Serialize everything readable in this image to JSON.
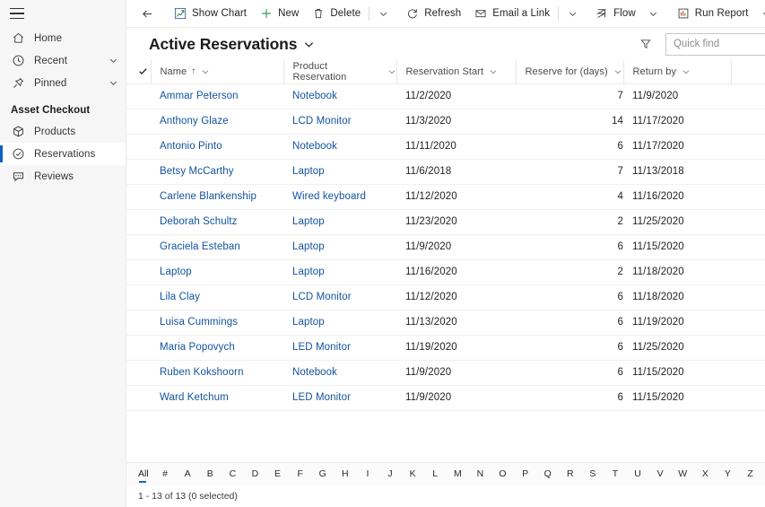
{
  "sidebar": {
    "menu_icon": "hamburger-icon",
    "top_items": [
      {
        "label": "Home",
        "icon": "home-icon",
        "chevron": false
      },
      {
        "label": "Recent",
        "icon": "clock-icon",
        "chevron": true
      },
      {
        "label": "Pinned",
        "icon": "pin-icon",
        "chevron": true
      }
    ],
    "group_title": "Asset Checkout",
    "group_items": [
      {
        "label": "Products",
        "icon": "box-icon",
        "selected": false
      },
      {
        "label": "Reservations",
        "icon": "check-circle-icon",
        "selected": true
      },
      {
        "label": "Reviews",
        "icon": "comment-icon",
        "selected": false
      }
    ],
    "accent_color": "#0a64c2",
    "background_color": "#f6f6f6"
  },
  "commandbar": {
    "back": "back-arrow-icon",
    "items": [
      {
        "label": "Show Chart",
        "icon": "chart-icon",
        "chevron": false,
        "sep_after": false
      },
      {
        "label": "New",
        "icon": "plus-icon",
        "chevron": false,
        "sep_after": false
      },
      {
        "label": "Delete",
        "icon": "trash-icon",
        "chevron": true,
        "sep_after": true
      },
      {
        "label": "Refresh",
        "icon": "refresh-icon",
        "chevron": false,
        "sep_after": false
      },
      {
        "label": "Email a Link",
        "icon": "email-icon",
        "chevron": true,
        "sep_after": true
      },
      {
        "label": "Flow",
        "icon": "flow-icon",
        "chevron": true,
        "sep_after": false
      },
      {
        "label": "Run Report",
        "icon": "report-icon",
        "chevron": true,
        "sep_after": false
      }
    ],
    "overflow": "more-options-icon"
  },
  "view": {
    "title": "Active Reservations",
    "title_chevron": "chevron-down-icon",
    "filter_icon": "filter-icon",
    "search": {
      "placeholder": "Quick find",
      "value": "",
      "icon": "search-icon"
    }
  },
  "grid": {
    "columns": [
      {
        "label": "Name",
        "sorted": true,
        "sort_arrow": "↑",
        "align": "left"
      },
      {
        "label": "Product Reservation",
        "sorted": false,
        "align": "left"
      },
      {
        "label": "Reservation Start",
        "sorted": false,
        "align": "left"
      },
      {
        "label": "Reserve for (days)",
        "sorted": false,
        "align": "right"
      },
      {
        "label": "Return by",
        "sorted": false,
        "align": "left"
      }
    ],
    "select_all_icon": "checkmark-icon",
    "rows": [
      {
        "name": "Ammar Peterson",
        "product": "Notebook",
        "start": "11/2/2020",
        "days": "7",
        "return": "11/9/2020"
      },
      {
        "name": "Anthony Glaze",
        "product": "LCD Monitor",
        "start": "11/3/2020",
        "days": "14",
        "return": "11/17/2020"
      },
      {
        "name": "Antonio Pinto",
        "product": "Notebook",
        "start": "11/11/2020",
        "days": "6",
        "return": "11/17/2020"
      },
      {
        "name": "Betsy McCarthy",
        "product": "Laptop",
        "start": "11/6/2018",
        "days": "7",
        "return": "11/13/2018"
      },
      {
        "name": "Carlene Blankenship",
        "product": "Wired keyboard",
        "start": "11/12/2020",
        "days": "4",
        "return": "11/16/2020"
      },
      {
        "name": "Deborah Schultz",
        "product": "Laptop",
        "start": "11/23/2020",
        "days": "2",
        "return": "11/25/2020"
      },
      {
        "name": "Graciela Esteban",
        "product": "Laptop",
        "start": "11/9/2020",
        "days": "6",
        "return": "11/15/2020"
      },
      {
        "name": "Laptop",
        "product": "Laptop",
        "start": "11/16/2020",
        "days": "2",
        "return": "11/18/2020"
      },
      {
        "name": "Lila Clay",
        "product": "LCD Monitor",
        "start": "11/12/2020",
        "days": "6",
        "return": "11/18/2020"
      },
      {
        "name": "Luisa Cummings",
        "product": "Laptop",
        "start": "11/13/2020",
        "days": "6",
        "return": "11/19/2020"
      },
      {
        "name": "Maria Popovych",
        "product": "LED Monitor",
        "start": "11/19/2020",
        "days": "6",
        "return": "11/25/2020"
      },
      {
        "name": "Ruben Kokshoorn",
        "product": "Notebook",
        "start": "11/9/2020",
        "days": "6",
        "return": "11/15/2020"
      },
      {
        "name": "Ward Ketchum",
        "product": "LED Monitor",
        "start": "11/9/2020",
        "days": "6",
        "return": "11/15/2020"
      }
    ],
    "link_color": "#12529d"
  },
  "alphabar": {
    "active": "All",
    "items": [
      "All",
      "#",
      "A",
      "B",
      "C",
      "D",
      "E",
      "F",
      "G",
      "H",
      "I",
      "J",
      "K",
      "L",
      "M",
      "N",
      "O",
      "P",
      "Q",
      "R",
      "S",
      "T",
      "U",
      "V",
      "W",
      "X",
      "Y",
      "Z"
    ]
  },
  "statusbar": {
    "text": "1 - 13 of 13 (0 selected)"
  }
}
